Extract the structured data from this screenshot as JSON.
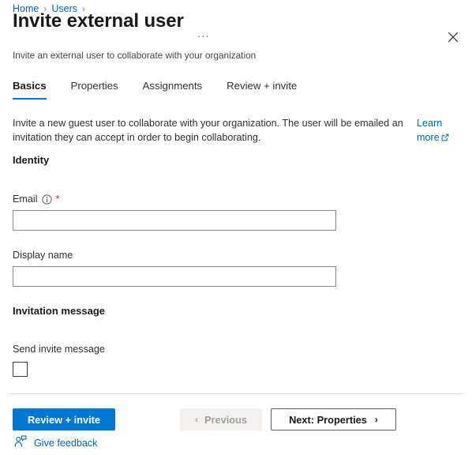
{
  "breadcrumb": {
    "items": [
      {
        "label": "Home"
      },
      {
        "label": "Users"
      }
    ],
    "separator": "›"
  },
  "header": {
    "title": "Invite external user",
    "subtitle": "Invite an external user to collaborate with your organization",
    "overflow_label": "···",
    "close_icon": "close-icon"
  },
  "tabs": [
    {
      "label": "Basics",
      "active": true
    },
    {
      "label": "Properties",
      "active": false
    },
    {
      "label": "Assignments",
      "active": false
    },
    {
      "label": "Review + invite",
      "active": false
    }
  ],
  "intro": {
    "text": "Invite a new guest user to collaborate with your organization. The user will be emailed an invitation they can accept in order to begin collaborating.",
    "learn_more_label": "Learn more",
    "learn_more_icon": "external-link-icon"
  },
  "sections": {
    "identity": {
      "heading": "Identity",
      "email": {
        "label": "Email",
        "info_icon": "info-icon",
        "required_marker": "*",
        "value": "",
        "placeholder": ""
      },
      "display_name": {
        "label": "Display name",
        "value": "",
        "placeholder": ""
      }
    },
    "invitation": {
      "heading": "Invitation message",
      "send_invite": {
        "label": "Send invite message",
        "checked": false
      }
    }
  },
  "footer": {
    "primary_button": "Review + invite",
    "previous_button": "Previous",
    "previous_chevron": "‹",
    "next_button": "Next: Properties",
    "next_chevron": "›",
    "feedback_label": "Give feedback",
    "feedback_icon": "person-feedback-icon"
  },
  "colors": {
    "accent": "#0078d4",
    "link": "#0067b8",
    "required": "#a4262c",
    "text": "#323130"
  }
}
